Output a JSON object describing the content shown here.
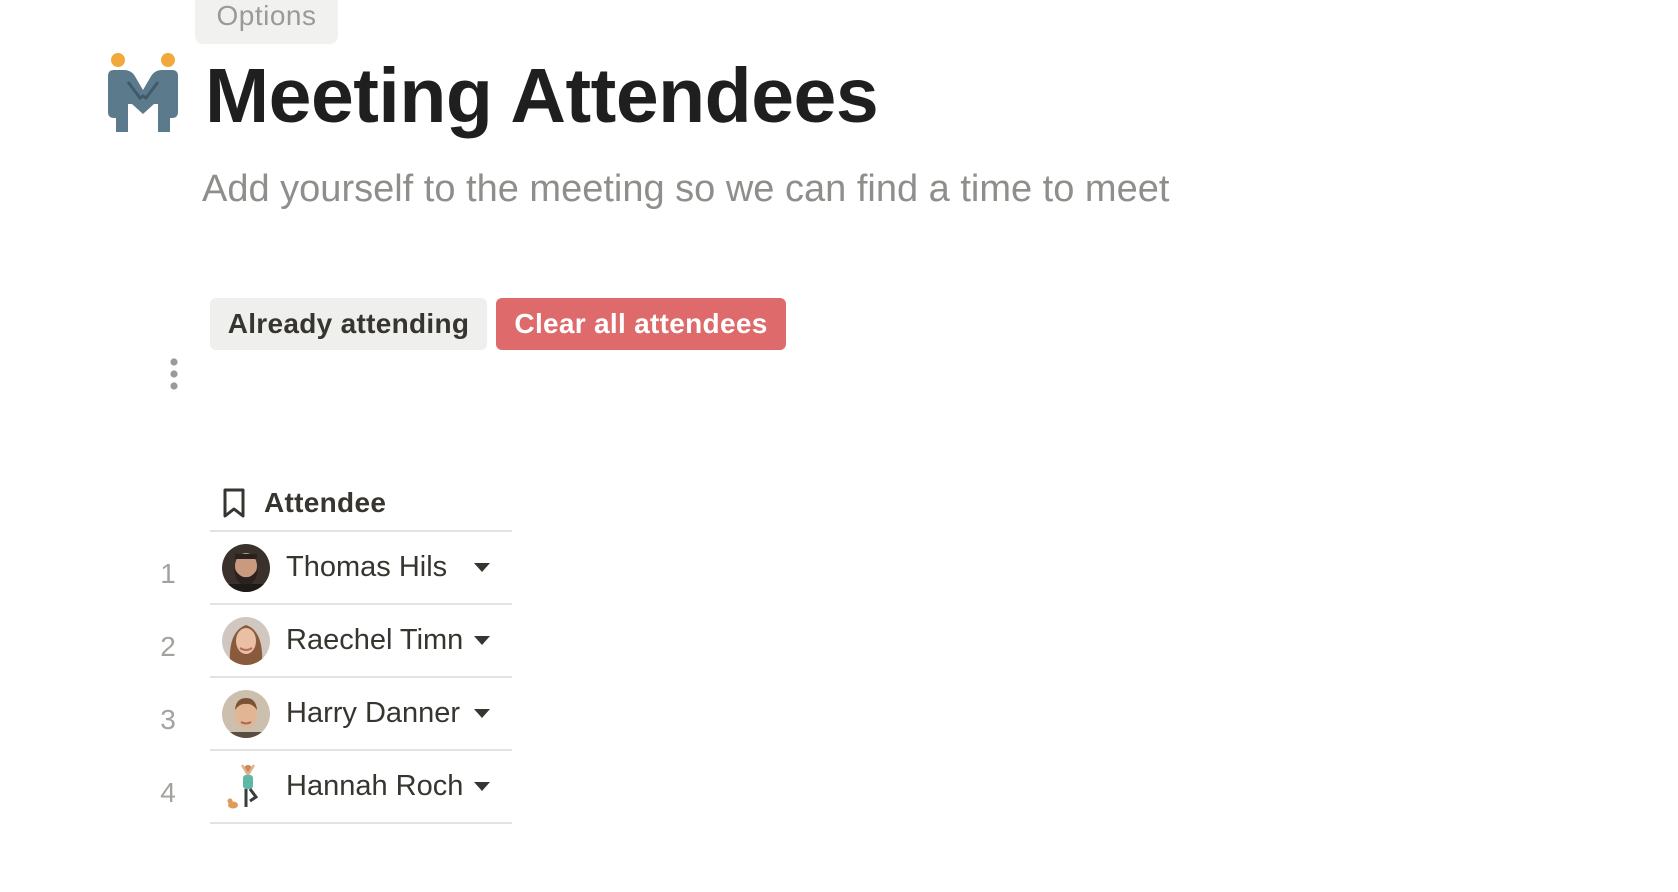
{
  "header": {
    "options_label": "Options",
    "title": "Meeting Attendees",
    "subtitle": "Add yourself to the meeting so we can find a time to meet",
    "icon": "handshake-people-icon"
  },
  "actions": {
    "already_attending_label": "Already attending",
    "clear_all_label": "Clear all attendees",
    "more_icon": "kebab-menu-icon"
  },
  "table": {
    "column": {
      "label": "Attendee",
      "icon": "bookmark-icon"
    },
    "rows": [
      {
        "number": "1",
        "name": "Thomas Hils",
        "avatar": "bearded-man-avatar"
      },
      {
        "number": "2",
        "name": "Raechel Timn",
        "avatar": "woman-avatar"
      },
      {
        "number": "3",
        "name": "Harry Danner",
        "avatar": "man-avatar"
      },
      {
        "number": "4",
        "name": "Hannah Roch",
        "avatar": "yoga-illustration-avatar"
      }
    ]
  },
  "colors": {
    "danger": "#de6a6c",
    "secondary": "#efefed",
    "icon_accent": "#f2a93b",
    "icon_body": "#5b7a8c"
  }
}
